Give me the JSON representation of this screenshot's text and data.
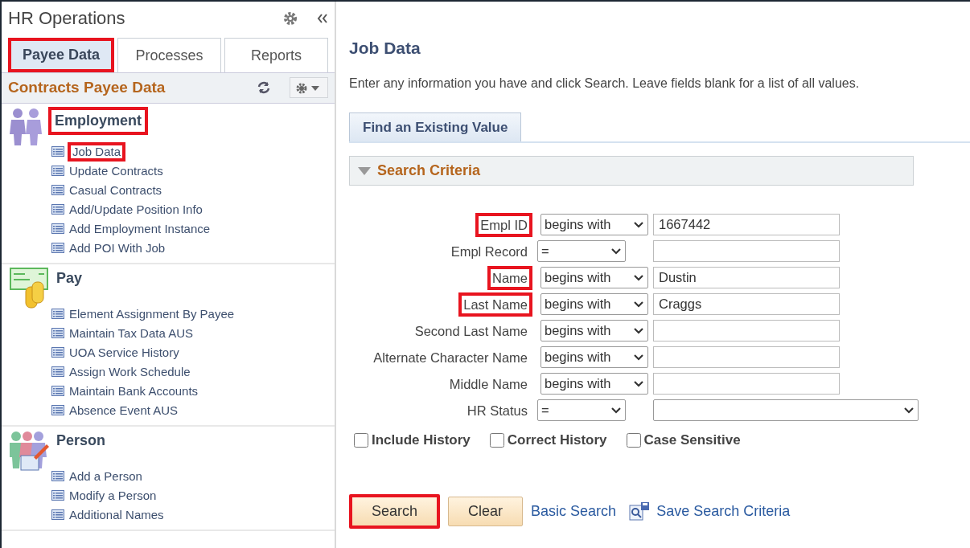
{
  "sidebar": {
    "title": "HR Operations",
    "tabs": [
      {
        "label": "Payee Data",
        "selected": true,
        "highlighted": true
      },
      {
        "label": "Processes",
        "selected": false,
        "highlighted": false
      },
      {
        "label": "Reports",
        "selected": false,
        "highlighted": false
      }
    ],
    "section_title": "Contracts Payee Data",
    "groups": [
      {
        "title": "Employment",
        "kind": "employment",
        "highlighted": true,
        "items": [
          {
            "label": "Job Data",
            "highlighted": true
          },
          {
            "label": "Update Contracts",
            "highlighted": false
          },
          {
            "label": "Casual Contracts",
            "highlighted": false
          },
          {
            "label": "Add/Update Position Info",
            "highlighted": false
          },
          {
            "label": "Add Employment Instance",
            "highlighted": false
          },
          {
            "label": "Add POI With Job",
            "highlighted": false
          }
        ]
      },
      {
        "title": "Pay",
        "kind": "pay",
        "highlighted": false,
        "items": [
          {
            "label": "Element Assignment By Payee",
            "highlighted": false
          },
          {
            "label": "Maintain Tax Data AUS",
            "highlighted": false
          },
          {
            "label": "UOA Service History",
            "highlighted": false
          },
          {
            "label": "Assign Work Schedule",
            "highlighted": false
          },
          {
            "label": "Maintain Bank Accounts",
            "highlighted": false
          },
          {
            "label": "Absence Event AUS",
            "highlighted": false
          }
        ]
      },
      {
        "title": "Person",
        "kind": "person",
        "highlighted": false,
        "items": [
          {
            "label": "Add a Person",
            "highlighted": false
          },
          {
            "label": "Modify a Person",
            "highlighted": false
          },
          {
            "label": "Additional Names",
            "highlighted": false
          }
        ]
      }
    ]
  },
  "main": {
    "title": "Job Data",
    "instructions": "Enter any information you have and click Search. Leave fields blank for a list of all values.",
    "tab": "Find an Existing Value",
    "panel_title": "Search Criteria",
    "criteria": [
      {
        "label": "Empl ID",
        "kind": "text",
        "operator": "begins with",
        "value": "1667442",
        "highlighted": true
      },
      {
        "label": "Empl Record",
        "kind": "number",
        "operator": "=",
        "highlighted": false
      },
      {
        "label": "Name",
        "kind": "text",
        "operator": "begins with",
        "value": "Dustin",
        "highlighted": true
      },
      {
        "label": "Last Name",
        "kind": "text",
        "operator": "begins with",
        "value": "Craggs",
        "highlighted": true
      },
      {
        "label": "Second Last Name",
        "kind": "text",
        "operator": "begins with",
        "highlighted": false
      },
      {
        "label": "Alternate Character Name",
        "kind": "text",
        "operator": "begins with",
        "highlighted": false
      },
      {
        "label": "Middle Name",
        "kind": "text",
        "operator": "begins with",
        "highlighted": false
      },
      {
        "label": "HR Status",
        "kind": "status",
        "operator": "=",
        "highlighted": false
      }
    ],
    "checkboxes": [
      {
        "label": "Include History",
        "checked": false
      },
      {
        "label": "Correct History",
        "checked": false
      },
      {
        "label": "Case Sensitive",
        "checked": false
      }
    ],
    "buttons": [
      {
        "label": "Search",
        "highlighted": true
      },
      {
        "label": "Clear",
        "highlighted": false
      }
    ],
    "basic_search_link": "Basic Search",
    "save_search_link": "Save Search Criteria"
  }
}
